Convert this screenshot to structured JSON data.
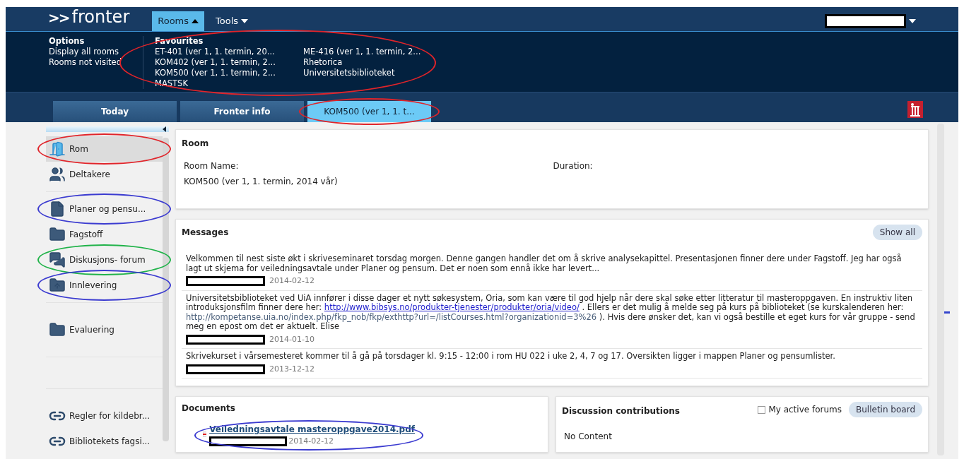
{
  "header": {
    "logo_arrows": ">>",
    "logo_word": "fronter",
    "menus": [
      {
        "label": "Rooms",
        "selected": true
      },
      {
        "label": "Tools",
        "selected": false
      }
    ],
    "user_redacted": true
  },
  "dropdown": {
    "options": {
      "title": "Options",
      "items": [
        "Display all rooms",
        "Rooms not visited"
      ]
    },
    "favourites": {
      "title": "Favourites",
      "color": "#e0242a",
      "columns": [
        [
          "ET-401 (ver 1, 1. termin, 20...",
          "KOM402 (ver 1, 1. termin, 2...",
          "KOM500 (ver 1, 1. termin, 2...",
          "MASTSK"
        ],
        [
          "ME-416 (ver 1, 1. termin, 2...",
          "Rhetorica",
          "Universitetsbiblioteket"
        ]
      ]
    }
  },
  "tabs": [
    {
      "label": "Today",
      "selected": false
    },
    {
      "label": "Fronter info",
      "selected": false
    },
    {
      "label": "KOM500 (ver 1, 1. t...",
      "selected": true,
      "color": "#e0242a"
    }
  ],
  "sidebar": {
    "groups": [
      [
        {
          "kind": "room",
          "label": "Rom",
          "selected": true,
          "color": "#e0242a"
        },
        {
          "kind": "people",
          "label": "Deltakere",
          "selected": false
        }
      ],
      [
        {
          "kind": "document",
          "label": "Planer og pensu...",
          "selected": false,
          "color": "#3b3bd0"
        },
        {
          "kind": "folder",
          "label": "Fagstoff",
          "selected": false
        },
        {
          "kind": "forum",
          "label": "Diskusjons- forum",
          "selected": false,
          "color": "#21b34a"
        },
        {
          "kind": "upload",
          "label": "Innlevering",
          "selected": false,
          "color": "#3b3bd0"
        }
      ],
      [
        {
          "kind": "folder",
          "label": "Evaluering",
          "selected": false
        }
      ]
    ],
    "links": [
      {
        "kind": "link",
        "label": "Regler for kildebr...",
        "selected": false
      },
      {
        "kind": "link",
        "label": "Bibliotekets fagsi...",
        "selected": false
      }
    ]
  },
  "room": {
    "title": "Room",
    "fields": [
      {
        "label": "Room Name:",
        "value": "KOM500 (ver 1, 1. termin, 2014 vår)"
      },
      {
        "label": "Duration:"
      }
    ]
  },
  "messages": {
    "title": "Messages",
    "button": "Show all",
    "items": [
      {
        "parts": [
          {
            "kind": "text",
            "text": "Velkommen til nest siste økt i skriveseminaret torsdag morgen. Denne gangen handler det om å skrive analysekapittel. Presentasjonen finner dere under Fagstoff. Jeg har også lagt ut skjema for veiledningsavtale under Planer og pensum. Det er noen som ennå ikke har levert..."
          }
        ],
        "author_redacted": true,
        "date": "2014-02-12"
      },
      {
        "parts": [
          {
            "kind": "text",
            "text": "Universitetsbiblioteket ved UiA innfører i disse dager et nytt søkesystem, Oria, som kan være til god hjelp når dere skal søke etter litteratur til masteroppgaven. En instruktiv liten introduksjonsfilm finner dere her: "
          },
          {
            "kind": "link",
            "text": "http://www.bibsys.no/produkter-tjenester/produkter/oria/video/"
          },
          {
            "kind": "text",
            "text": " . Ellers er det mulig å melde seg på kurs på biblioteket (se kurskalenderen her: "
          },
          {
            "kind": "url",
            "text": "http://kompetanse.uia.no/index.php/fkp_nob/fkp/exthttp?url=/listCourses.html?organizationid=3%26"
          },
          {
            "kind": "text",
            "text": " ). Hvis dere ønsker det, kan vi også bestille et eget kurs for vår gruppe - send meg en epost om det er aktuelt. Elise"
          }
        ],
        "author_redacted": true,
        "date": "2014-01-10"
      },
      {
        "parts": [
          {
            "kind": "text",
            "text": "Skrivekurset i vårsemesteret kommer til å gå på torsdager kl. 9:15 - 12:00 i rom HU 022 i uke 2, 4, 7 og 17. Oversikten ligger i mappen Planer og pensumlister."
          }
        ],
        "author_redacted": true,
        "date": "2013-12-12"
      }
    ]
  },
  "documents": {
    "title": "Documents",
    "files": [
      {
        "name": "Veiledningsavtale masteroppgave2014.pdf",
        "author_redacted": true,
        "date": "2014-02-12",
        "color": "#3b3bd0"
      }
    ]
  },
  "discussion": {
    "title": "Discussion contributions",
    "checkbox": {
      "label": "My active forums",
      "checked": false
    },
    "button": "Bulletin board",
    "empty": "No Content"
  }
}
